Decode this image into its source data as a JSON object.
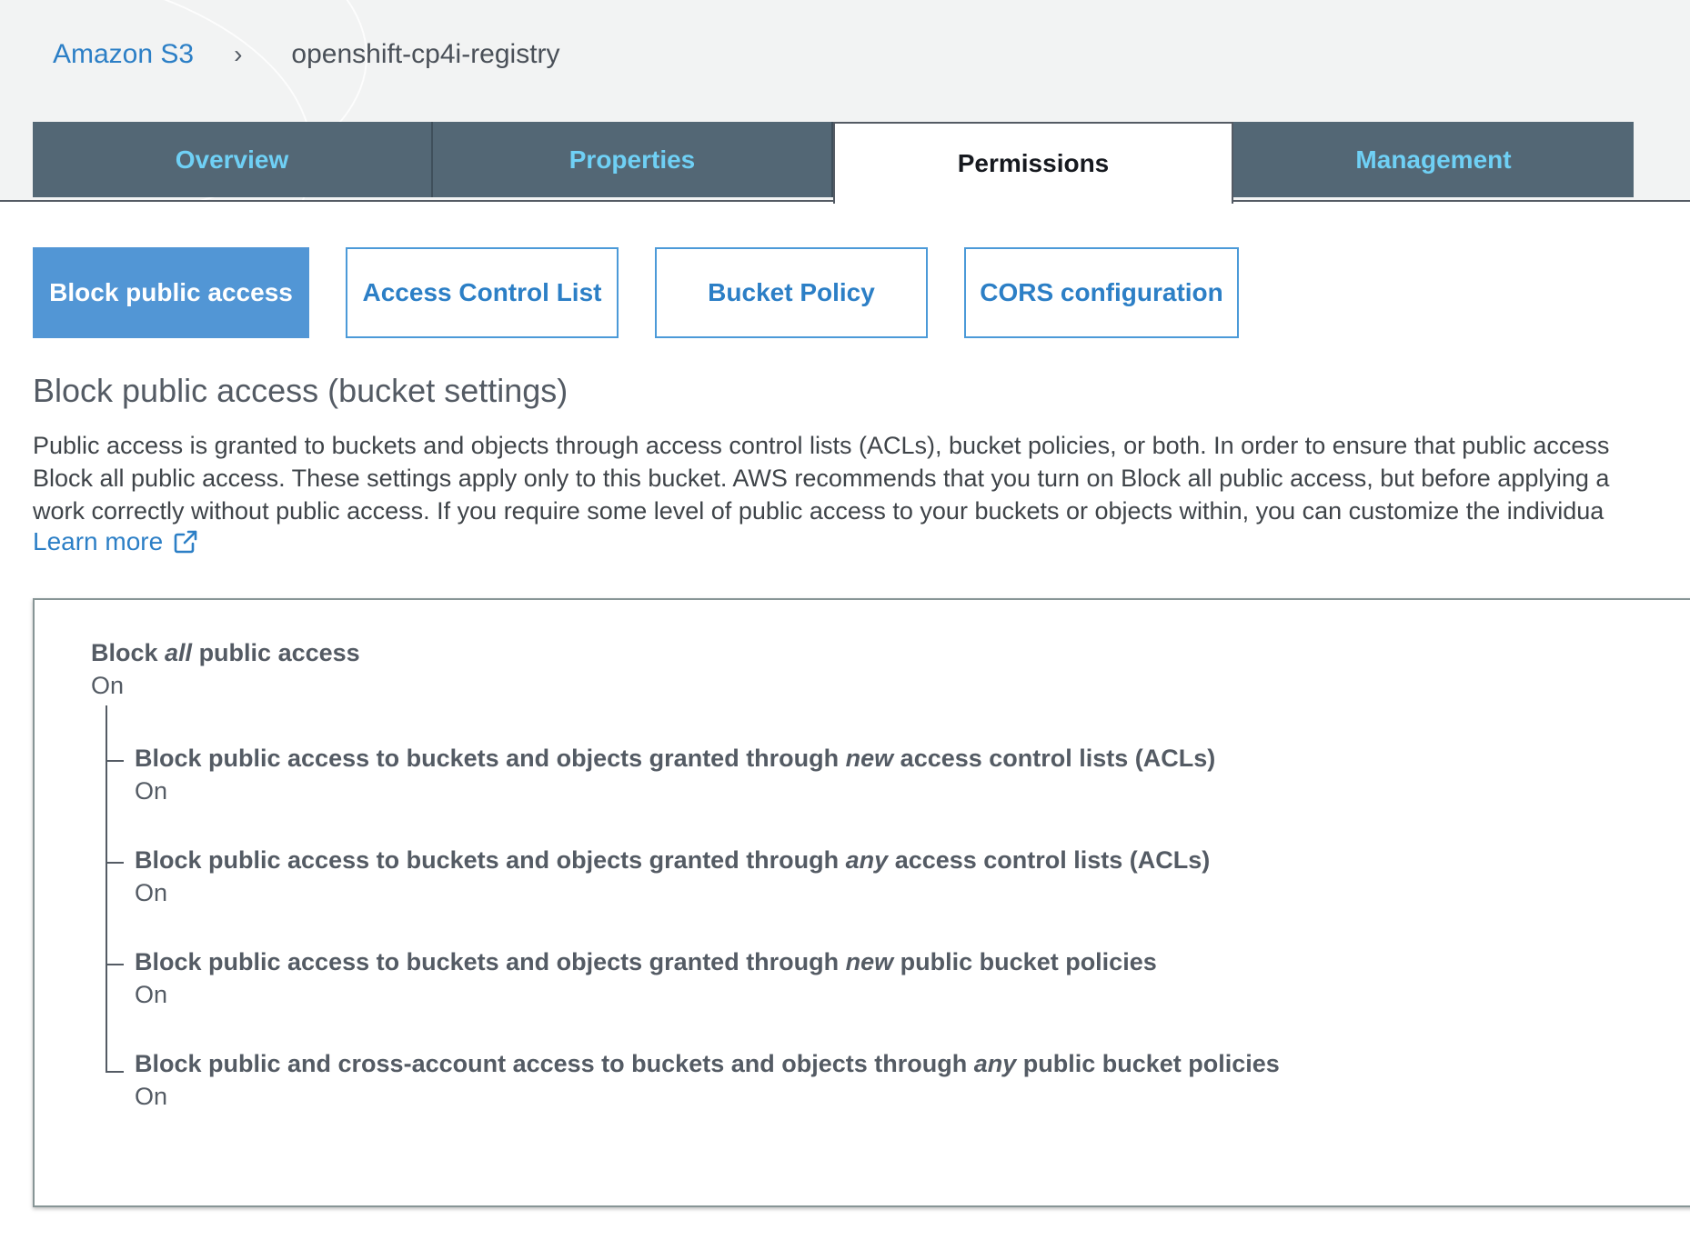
{
  "breadcrumb": {
    "root": "Amazon S3",
    "separator": "›",
    "current": "openshift-cp4i-registry"
  },
  "tabs": [
    {
      "label": "Overview",
      "active": false
    },
    {
      "label": "Properties",
      "active": false
    },
    {
      "label": "Permissions",
      "active": true
    },
    {
      "label": "Management",
      "active": false
    }
  ],
  "subtabs": [
    {
      "label": "Block public access",
      "active": true
    },
    {
      "label": "Access Control List",
      "active": false
    },
    {
      "label": "Bucket Policy",
      "active": false
    },
    {
      "label": "CORS configuration",
      "active": false
    }
  ],
  "section": {
    "title": "Block public access (bucket settings)",
    "description_lines": [
      "Public access is granted to buckets and objects through access control lists (ACLs), bucket policies, or both. In order to ensure that public access",
      "Block all public access. These settings apply only to this bucket. AWS recommends that you turn on Block all public access, but before applying a",
      "work correctly without public access. If you require some level of public access to your buckets or objects within, you can customize the individua"
    ],
    "learn_more": "Learn more"
  },
  "settings": {
    "main": {
      "label_pre": "Block ",
      "label_em": "all",
      "label_post": " public access",
      "value": "On"
    },
    "children": [
      {
        "label_pre": "Block public access to buckets and objects granted through ",
        "label_em": "new",
        "label_post": " access control lists (ACLs)",
        "value": "On"
      },
      {
        "label_pre": "Block public access to buckets and objects granted through ",
        "label_em": "any",
        "label_post": " access control lists (ACLs)",
        "value": "On"
      },
      {
        "label_pre": "Block public access to buckets and objects granted through ",
        "label_em": "new",
        "label_post": " public bucket policies",
        "value": "On"
      },
      {
        "label_pre": "Block public and cross-account access to buckets and objects through ",
        "label_em": "any",
        "label_post": " public bucket policies",
        "value": "On"
      }
    ]
  },
  "colors": {
    "link": "#2c7fc6",
    "tab_bg": "#536775",
    "tab_text": "#6fd0f5",
    "subtab_active_bg": "#5296d5"
  },
  "icons": {
    "learn_more": "external-link-icon",
    "breadcrumb_sep": "chevron-right-icon"
  }
}
